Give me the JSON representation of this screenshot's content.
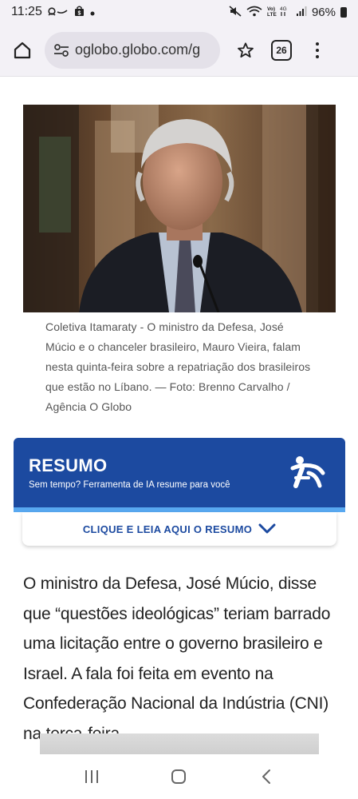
{
  "status_bar": {
    "time": "11:25",
    "battery": "96%",
    "left_icons": [
      "voicemail-icon",
      "shopping-bag-icon",
      "dot-icon"
    ],
    "right_icons": [
      "mute-icon",
      "wifi-icon",
      "volte-icon",
      "signal-icon",
      "battery-icon"
    ]
  },
  "browser": {
    "url": "oglobo.globo.com/g",
    "tab_count": "26"
  },
  "photo": {
    "caption": "Coletiva Itamaraty - O ministro da Defesa, José Múcio e o chanceler brasileiro, Mauro Vieira, falam nesta quinta-feira sobre a repatriação dos brasileiros que estão no Líbano. — Foto: Brenno Carvalho / Agência O Globo"
  },
  "resumo": {
    "title": "RESUMO",
    "subtitle": "Sem tempo? Ferramenta de IA resume para você",
    "button_label": "CLIQUE E LEIA AQUI O RESUMO",
    "accent": "#1c4aa0",
    "stripe": "#58a8f0"
  },
  "article": {
    "paragraph": "O ministro da Defesa, José Múcio, disse que “questões ideológicas” teriam barrado uma licitação entre o governo brasileiro e Israel. A fala foi feita em evento na Confederação Nacional da Indústria (CNI) na terça-feira."
  }
}
